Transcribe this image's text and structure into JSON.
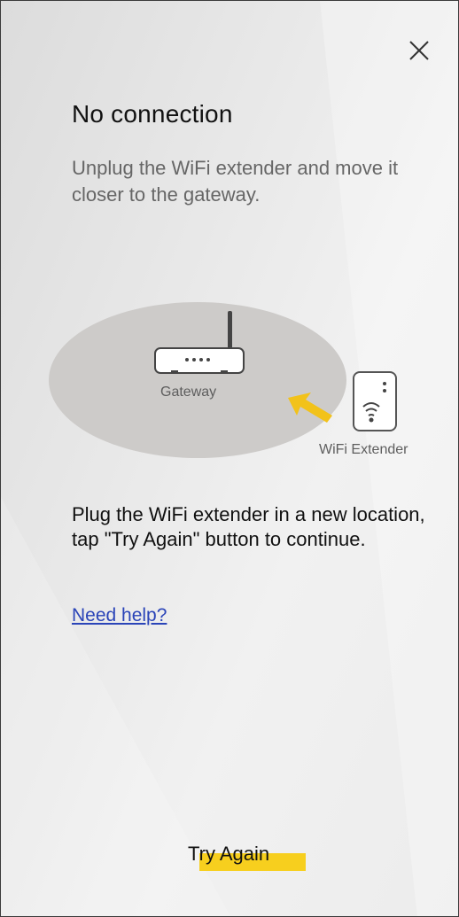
{
  "screen": {
    "title": "No connection",
    "subtitle": "Unplug the WiFi extender and move it closer to the gateway.",
    "close_icon": "close-icon"
  },
  "illustration": {
    "gateway_label": "Gateway",
    "extender_label": "WiFi Extender",
    "icons": [
      "router-icon",
      "arrow-icon",
      "wifi-extender-icon"
    ]
  },
  "instruction": "Plug the WiFi extender in a new location, tap \"Try Again\" button to continue.",
  "help_link": "Need help?",
  "primary_action": "Try Again",
  "colors": {
    "accent_highlight": "#f7cf1e",
    "arrow": "#f2c21a",
    "link": "#2a44b8",
    "gateway_area": "#cdcbc9"
  }
}
